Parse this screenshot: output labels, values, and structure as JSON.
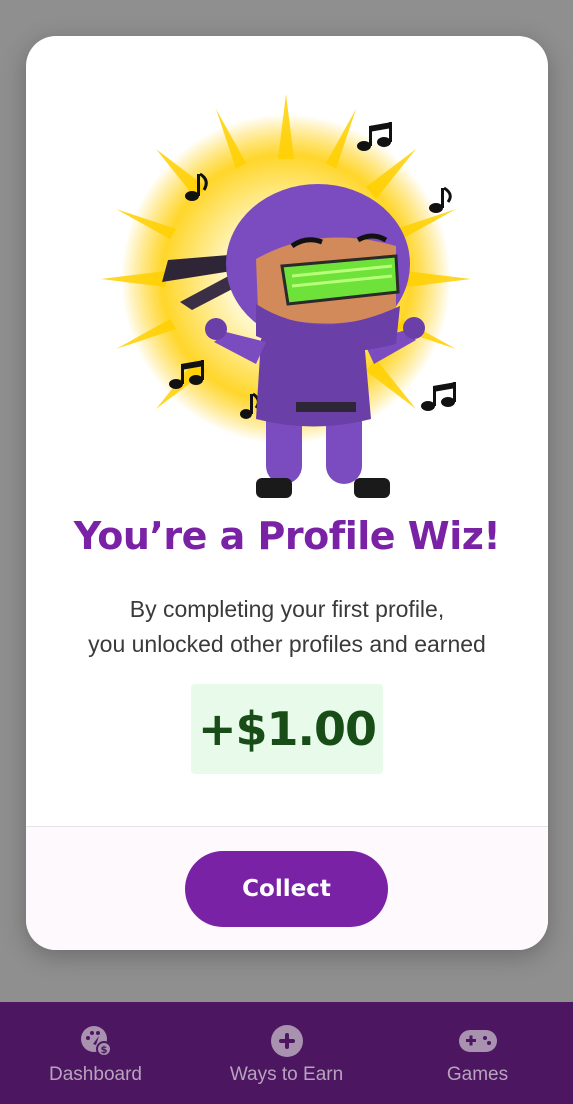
{
  "modal": {
    "title": "You’re a Profile Wiz!",
    "message_lines": [
      "By completing your first profile,",
      "you unlocked other profiles and earned"
    ],
    "reward_amount": "+$1.00",
    "collect_label": "Collect"
  },
  "illustration": {
    "subject": "dancing purple ninja with green visor and music notes"
  },
  "bottom_nav": {
    "items": [
      {
        "label": "Dashboard",
        "icon": "dashboard-icon"
      },
      {
        "label": "Ways to Earn",
        "icon": "plus-circle-icon"
      },
      {
        "label": "Games",
        "icon": "gamepad-icon"
      }
    ]
  },
  "colors": {
    "accent": "#7a22a6",
    "nav_background": "#4c1760",
    "reward_text": "#184d17",
    "reward_background": "#e8fbea"
  }
}
